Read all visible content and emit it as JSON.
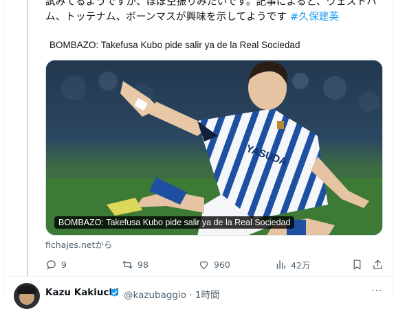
{
  "tweet": {
    "text_line1": "試みてるようですが、ほぼ空振りみたいです。記事によると、ウェストハ",
    "text_line2": "ム、トッテナム、ボーンマスが興味を示してようです",
    "hashtag": "#久保建英"
  },
  "card": {
    "title": "BOMBAZO: Takefusa Kubo pide salir ya de la Real Sociedad",
    "image_caption": "BOMBAZO: Takefusa Kubo pide salir ya de la Real Sociedad",
    "source": "fichajes.netから",
    "jersey_sponsor": "YASUDA"
  },
  "actions": {
    "replies": "9",
    "retweets": "98",
    "likes": "960",
    "views": "42万"
  },
  "next_tweet": {
    "name": "Kazu Kakiuchi",
    "handle_time": "@kazubaggio · 1時間",
    "more": "···"
  },
  "colors": {
    "link": "#1d9bf0",
    "secondary_text": "#536471",
    "primary_text": "#0f1419",
    "verified": "#1d9bf0"
  },
  "icons": [
    "reply-icon",
    "retweet-icon",
    "like-icon",
    "views-icon",
    "bookmark-icon",
    "share-icon",
    "verified-icon",
    "more-icon"
  ]
}
